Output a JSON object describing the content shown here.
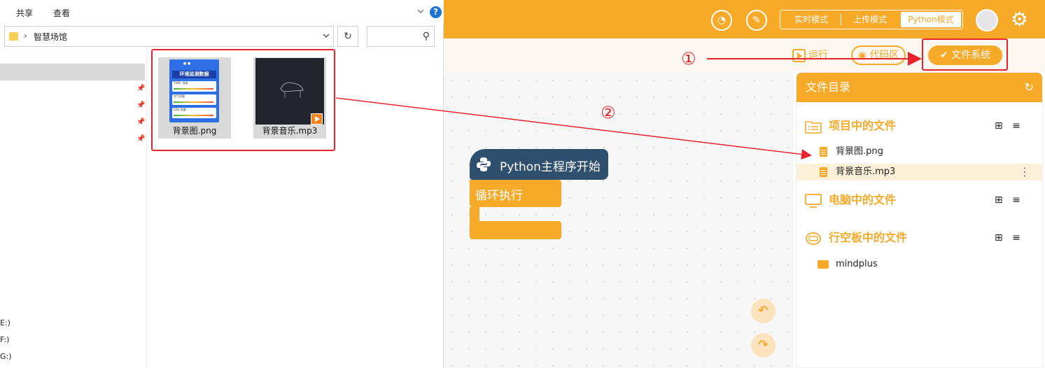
{
  "explorer": {
    "ribbon_tabs": [
      "共享",
      "查看"
    ],
    "help_label": "?",
    "address": {
      "separator": "›",
      "path": "智慧场馆"
    },
    "refresh_glyph": "↻",
    "search_glyph": "⚲",
    "nav_fragments": [
      "E:)",
      "F:)",
      "G:)"
    ],
    "files": [
      {
        "name": "背景图.png",
        "card_title": "环境监测数据",
        "card_rows": [
          "TVOC 浓度",
          "空气质量",
          "CO2 浓度"
        ],
        "header_dots": "● ●"
      },
      {
        "name": "背景音乐.mp3"
      }
    ]
  },
  "app": {
    "top_icons": [
      "dashboard-icon",
      "edit-icon"
    ],
    "top_icon_glyphs": [
      "◔",
      "✎"
    ],
    "modes": [
      "实时模式",
      "上传模式",
      "Python模式"
    ],
    "active_mode": "Python模式",
    "gear_glyph": "⚙",
    "toolbar": {
      "run": "运行",
      "code": "代码区",
      "file_system": "文件系统",
      "check_glyph": "✔"
    },
    "blocks": {
      "start": "Python主程序开始",
      "loop": "循环执行"
    },
    "workspace_tools": [
      "↶",
      "↷"
    ],
    "panel": {
      "title": "文件目录",
      "refresh_glyph": "↻",
      "sections": [
        {
          "title": "项目中的文件",
          "files": [
            "背景图.png",
            "背景音乐.mp3"
          ]
        },
        {
          "title": "电脑中的文件",
          "files": []
        },
        {
          "title": "行空板中的文件",
          "files": [
            "mindplus"
          ]
        }
      ],
      "section_actions": {
        "add": "⊞",
        "menu": "≡"
      },
      "kebab_glyph": "⋮"
    }
  },
  "annotations": {
    "step1": "①",
    "step2": "②"
  },
  "colors": {
    "accent": "#f7a928",
    "annotation": "#e8232d",
    "block_dark": "#2e4f6e"
  }
}
